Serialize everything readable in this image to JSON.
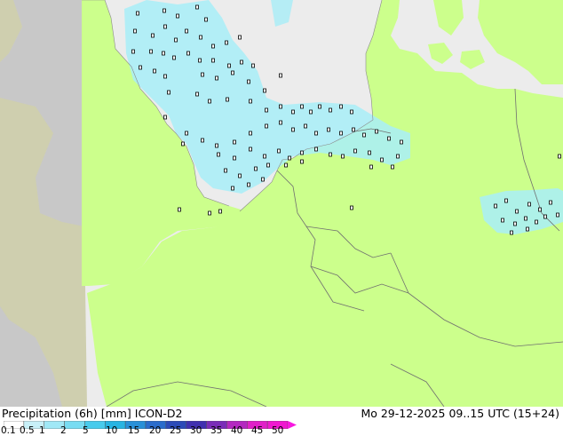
{
  "title": "Precipitation (6h) [mm] ICON-D2",
  "timestamp": "Mo 29-12-2025 09..15 UTC (15+24)",
  "legend": {
    "ticks": [
      "0.1",
      "0.5",
      "1",
      "2",
      "5",
      "10",
      "15",
      "20",
      "25",
      "30",
      "35",
      "40",
      "45",
      "50"
    ],
    "colors": [
      "#ffffff",
      "#c8f0f8",
      "#a0e8f6",
      "#78dcf2",
      "#48cbec",
      "#28b4e2",
      "#2890d8",
      "#2a6ccc",
      "#2c4ab8",
      "#4030b0",
      "#7a2cb8",
      "#b428c0",
      "#e020c8",
      "#f018d0",
      "#f818e0"
    ]
  },
  "colors": {
    "land": "#ccff8c",
    "sea": "#ececec",
    "outside": "#c8c8c8",
    "outside_land": "#cfcfaf",
    "precip": "#a8eef8",
    "borders": "#707070"
  }
}
